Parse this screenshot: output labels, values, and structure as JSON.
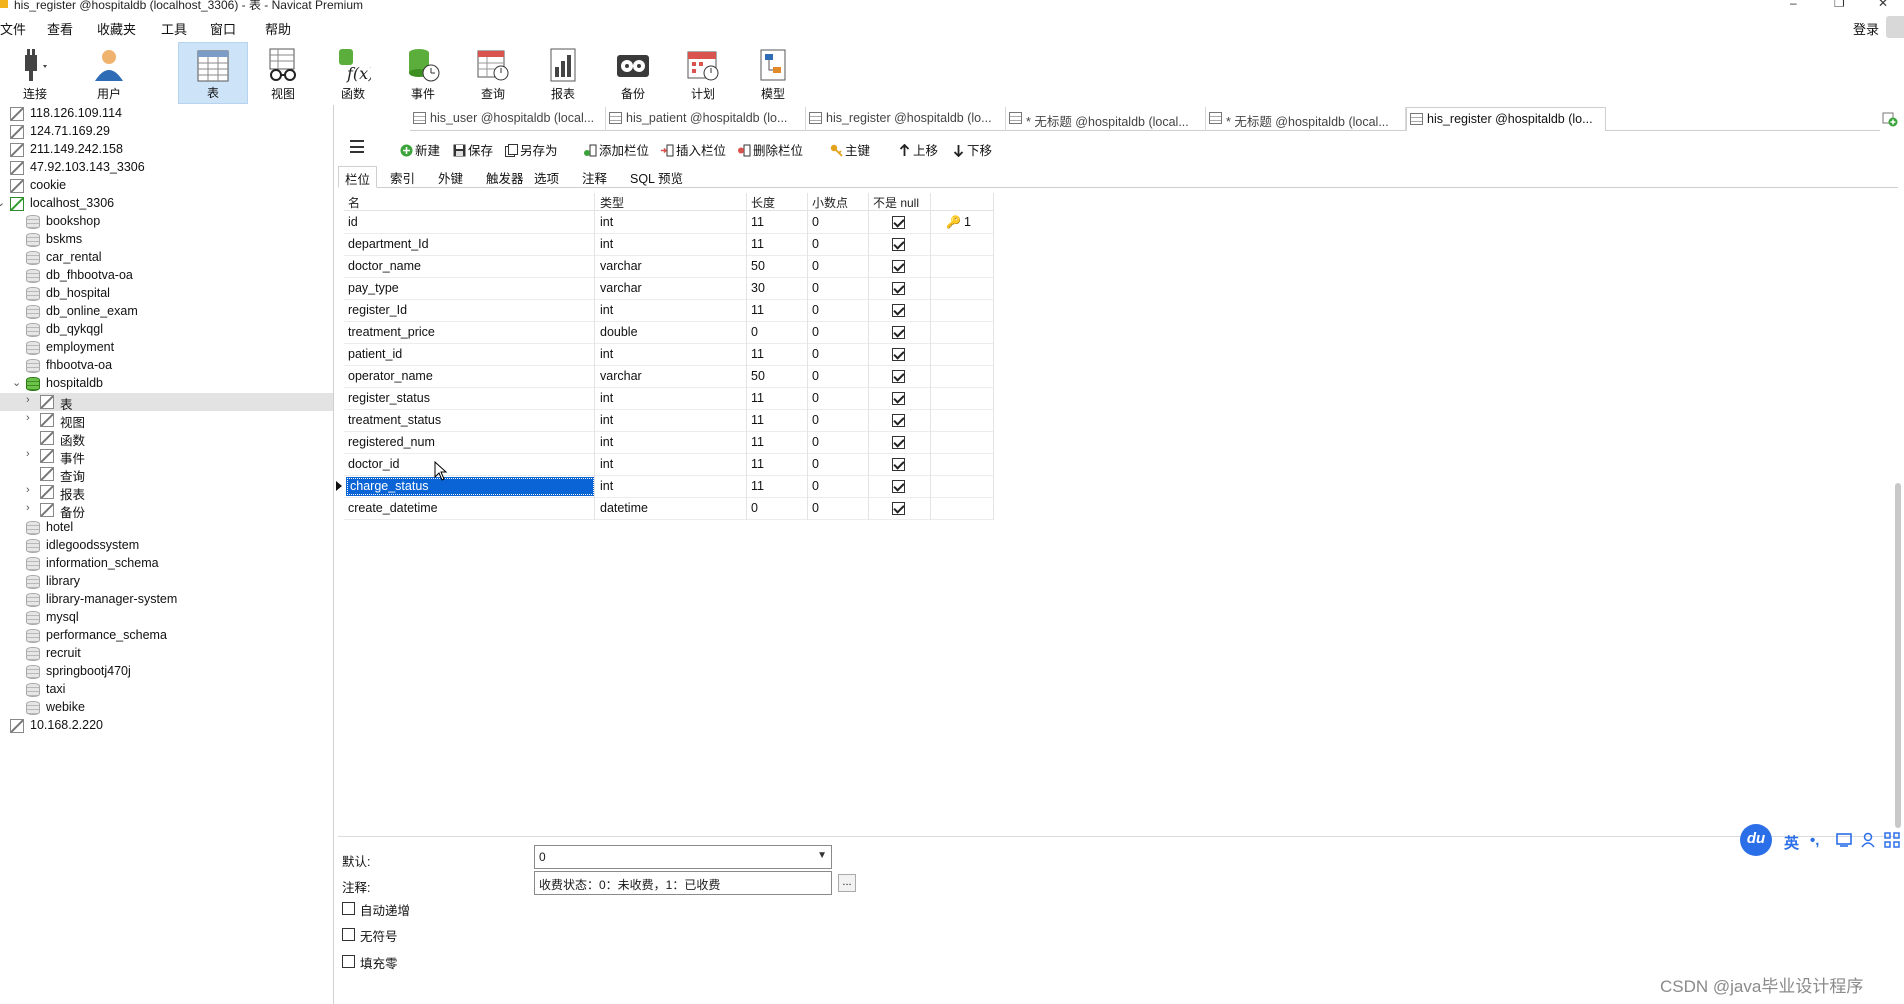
{
  "window": {
    "title": "his_register @hospitaldb (localhost_3306) - 表 - Navicat Premium",
    "minimize": "–",
    "restore": "❐",
    "close": "✕"
  },
  "menu": [
    "文件",
    "查看",
    "收藏夹",
    "工具",
    "窗口",
    "帮助"
  ],
  "login_label": "登录",
  "toolbar": [
    {
      "label": "连接",
      "icon": "connection-plug-icon"
    },
    {
      "label": "用户",
      "icon": "user-icon"
    },
    {
      "label": "表",
      "icon": "table-icon",
      "active": true
    },
    {
      "label": "视图",
      "icon": "view-glasses-icon"
    },
    {
      "label": "函数",
      "icon": "function-icon"
    },
    {
      "label": "事件",
      "icon": "event-icon"
    },
    {
      "label": "查询",
      "icon": "query-icon"
    },
    {
      "label": "报表",
      "icon": "report-icon"
    },
    {
      "label": "备份",
      "icon": "backup-icon"
    },
    {
      "label": "计划",
      "icon": "schedule-icon"
    },
    {
      "label": "模型",
      "icon": "model-icon"
    }
  ],
  "sidebar": {
    "items": [
      {
        "label": "118.126.109.114",
        "type": "connection"
      },
      {
        "label": "124.71.169.29",
        "type": "connection"
      },
      {
        "label": "211.149.242.158",
        "type": "connection"
      },
      {
        "label": "47.92.103.143_3306",
        "type": "connection"
      },
      {
        "label": "cookie",
        "type": "connection"
      },
      {
        "label": "localhost_3306",
        "type": "connection-open"
      },
      {
        "label": "bookshop",
        "type": "db"
      },
      {
        "label": "bskms",
        "type": "db"
      },
      {
        "label": "car_rental",
        "type": "db"
      },
      {
        "label": "db_fhbootva-oa",
        "type": "db"
      },
      {
        "label": "db_hospital",
        "type": "db"
      },
      {
        "label": "db_online_exam",
        "type": "db"
      },
      {
        "label": "db_qykqgl",
        "type": "db"
      },
      {
        "label": "employment",
        "type": "db"
      },
      {
        "label": "fhbootva-oa",
        "type": "db"
      },
      {
        "label": "hospitaldb",
        "type": "db-open"
      },
      {
        "label": "表",
        "type": "node-table"
      },
      {
        "label": "视图",
        "type": "node-view"
      },
      {
        "label": "函数",
        "type": "node-func"
      },
      {
        "label": "事件",
        "type": "node-event"
      },
      {
        "label": "查询",
        "type": "node-query"
      },
      {
        "label": "报表",
        "type": "node-report"
      },
      {
        "label": "备份",
        "type": "node-backup"
      },
      {
        "label": "hotel",
        "type": "db"
      },
      {
        "label": "idlegoodssystem",
        "type": "db"
      },
      {
        "label": "information_schema",
        "type": "db"
      },
      {
        "label": "library",
        "type": "db"
      },
      {
        "label": "library-manager-system",
        "type": "db"
      },
      {
        "label": "mysql",
        "type": "db"
      },
      {
        "label": "performance_schema",
        "type": "db"
      },
      {
        "label": "recruit",
        "type": "db"
      },
      {
        "label": "springbootj470j",
        "type": "db"
      },
      {
        "label": "taxi",
        "type": "db"
      },
      {
        "label": "webike",
        "type": "db"
      },
      {
        "label": "10.168.2.220",
        "type": "connection"
      }
    ]
  },
  "doc_tabs": [
    {
      "label": "his_user @hospitaldb (local..."
    },
    {
      "label": "his_patient @hospitaldb (lo..."
    },
    {
      "label": "his_register @hospitaldb (lo..."
    },
    {
      "label": "* 无标题 @hospitaldb (local..."
    },
    {
      "label": "* 无标题 @hospitaldb (local..."
    },
    {
      "label": "his_register @hospitaldb (lo...",
      "active": true
    }
  ],
  "actions": {
    "new": "新建",
    "save": "保存",
    "save_as": "另存为",
    "add_field": "添加栏位",
    "insert_field": "插入栏位",
    "delete_field": "删除栏位",
    "primary_key": "主键",
    "move_up": "上移",
    "move_down": "下移"
  },
  "sub_tabs": [
    "栏位",
    "索引",
    "外键",
    "触发器",
    "选项",
    "注释",
    "SQL 预览"
  ],
  "grid": {
    "headers": {
      "name": "名",
      "type": "类型",
      "length": "长度",
      "decimals": "小数点",
      "not_null": "不是 null",
      "key": ""
    },
    "rows": [
      {
        "name": "id",
        "type": "int",
        "length": "11",
        "decimals": "0",
        "not_null": true,
        "key": "1"
      },
      {
        "name": "department_Id",
        "type": "int",
        "length": "11",
        "decimals": "0",
        "not_null": true,
        "key": ""
      },
      {
        "name": "doctor_name",
        "type": "varchar",
        "length": "50",
        "decimals": "0",
        "not_null": true,
        "key": ""
      },
      {
        "name": "pay_type",
        "type": "varchar",
        "length": "30",
        "decimals": "0",
        "not_null": true,
        "key": ""
      },
      {
        "name": "register_Id",
        "type": "int",
        "length": "11",
        "decimals": "0",
        "not_null": true,
        "key": ""
      },
      {
        "name": "treatment_price",
        "type": "double",
        "length": "0",
        "decimals": "0",
        "not_null": true,
        "key": ""
      },
      {
        "name": "patient_id",
        "type": "int",
        "length": "11",
        "decimals": "0",
        "not_null": true,
        "key": ""
      },
      {
        "name": "operator_name",
        "type": "varchar",
        "length": "50",
        "decimals": "0",
        "not_null": true,
        "key": ""
      },
      {
        "name": "register_status",
        "type": "int",
        "length": "11",
        "decimals": "0",
        "not_null": true,
        "key": ""
      },
      {
        "name": "treatment_status",
        "type": "int",
        "length": "11",
        "decimals": "0",
        "not_null": true,
        "key": ""
      },
      {
        "name": "registered_num",
        "type": "int",
        "length": "11",
        "decimals": "0",
        "not_null": true,
        "key": ""
      },
      {
        "name": "doctor_id",
        "type": "int",
        "length": "11",
        "decimals": "0",
        "not_null": true,
        "key": ""
      },
      {
        "name": "charge_status",
        "type": "int",
        "length": "11",
        "decimals": "0",
        "not_null": true,
        "key": "",
        "selected": true
      },
      {
        "name": "create_datetime",
        "type": "datetime",
        "length": "0",
        "decimals": "0",
        "not_null": true,
        "key": ""
      }
    ]
  },
  "props": {
    "default_label": "默认:",
    "default_value": "0",
    "comment_label": "注释:",
    "comment_value": "收费状态：0：未收费，1：已收费",
    "ellipsis_button": "...",
    "auto_increment": "自动递增",
    "unsigned": "无符号",
    "zerofill": "填充零"
  },
  "ime": {
    "logo": "du",
    "lang": "英",
    "punct": "•,"
  },
  "watermark": "CSDN @java毕业设计程序",
  "colors": {
    "selection": "#0a64d6",
    "active_toolbar": "#cde3f7",
    "ime_blue": "#2b6fe8"
  }
}
